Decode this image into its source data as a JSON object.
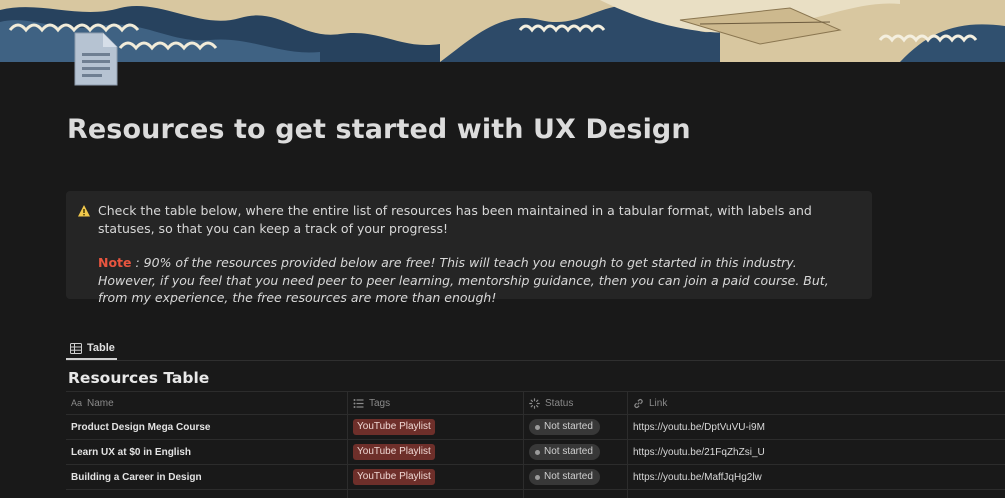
{
  "page": {
    "title": "Resources to get started with UX Design"
  },
  "callout": {
    "icon": "warning-icon",
    "text": "Check the table below, where the entire list of resources has been maintained in a tabular format, with labels and statuses, so that you can keep a track of your progress!",
    "note_label": "Note",
    "note_body": " : 90% of the resources provided below are free! This will teach you enough to get started in this industry. However, if you feel that you need peer to peer learning, mentorship guidance, then you can join a paid course. But, from my experience, the free resources are more than enough!"
  },
  "view": {
    "tab_label": "Table"
  },
  "database": {
    "title": "Resources Table",
    "columns": {
      "name": "Name",
      "name_prefix": "Aa",
      "tags": "Tags",
      "status": "Status",
      "link": "Link"
    },
    "rows": [
      {
        "name": "Product Design Mega Course",
        "tag": "YouTube Playlist",
        "status": "Not started",
        "link": "https://youtu.be/DptVuVU-i9M"
      },
      {
        "name": "Learn UX at $0 in English",
        "tag": "YouTube Playlist",
        "status": "Not started",
        "link": "https://youtu.be/21FqZhZsi_U"
      },
      {
        "name": "Building a Career in Design",
        "tag": "YouTube Playlist",
        "status": "Not started",
        "link": "https://youtu.be/MaffJqHg2lw"
      }
    ]
  },
  "colors": {
    "background": "#191919",
    "callout_bg": "#252525",
    "note_accent": "#e8553f",
    "tag_bg": "#6e2f2a"
  }
}
